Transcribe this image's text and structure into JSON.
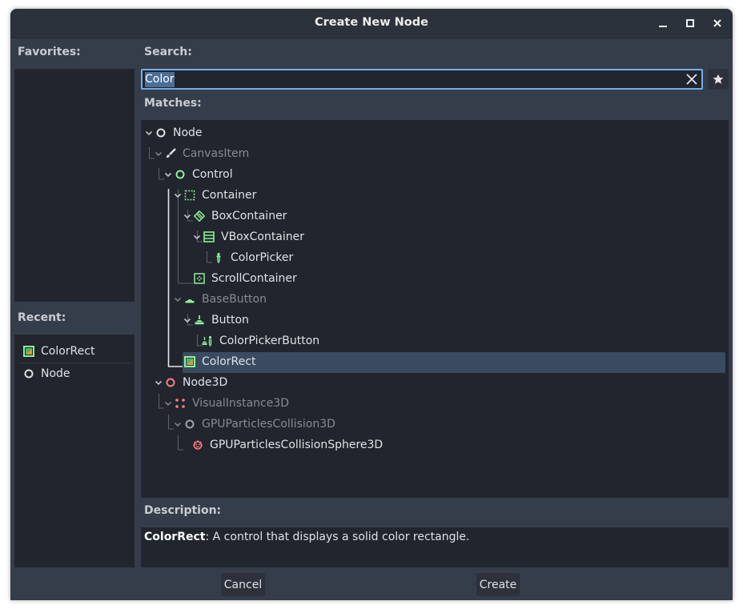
{
  "window": {
    "title": "Create New Node"
  },
  "favorites": {
    "label": "Favorites:"
  },
  "recent": {
    "label": "Recent:",
    "items": [
      {
        "label": "ColorRect",
        "icon": "colorrect-icon"
      },
      {
        "label": "Node",
        "icon": "node-icon"
      }
    ]
  },
  "search": {
    "label": "Search:",
    "value": "Color"
  },
  "matches": {
    "label": "Matches:",
    "items": [
      {
        "label": "Node",
        "icon": "node-icon",
        "dimmed": false
      },
      {
        "label": "CanvasItem",
        "icon": "canvasitem-icon",
        "dimmed": true
      },
      {
        "label": "Control",
        "icon": "control-icon",
        "dimmed": false
      },
      {
        "label": "Container",
        "icon": "container-icon",
        "dimmed": false
      },
      {
        "label": "BoxContainer",
        "icon": "boxcontainer-icon",
        "dimmed": false
      },
      {
        "label": "VBoxContainer",
        "icon": "vboxcontainer-icon",
        "dimmed": false
      },
      {
        "label": "ColorPicker",
        "icon": "colorpicker-icon",
        "dimmed": false
      },
      {
        "label": "ScrollContainer",
        "icon": "scrollcontainer-icon",
        "dimmed": false
      },
      {
        "label": "BaseButton",
        "icon": "basebutton-icon",
        "dimmed": true
      },
      {
        "label": "Button",
        "icon": "button-icon",
        "dimmed": false
      },
      {
        "label": "ColorPickerButton",
        "icon": "colorpickerbutton-icon",
        "dimmed": false
      },
      {
        "label": "ColorRect",
        "icon": "colorrect-icon",
        "dimmed": false,
        "selected": true
      },
      {
        "label": "Node3D",
        "icon": "node3d-icon",
        "dimmed": false
      },
      {
        "label": "VisualInstance3D",
        "icon": "visualinstance3d-icon",
        "dimmed": true
      },
      {
        "label": "GPUParticlesCollision3D",
        "icon": "gpuparticlescollision3d-icon",
        "dimmed": true
      },
      {
        "label": "GPUParticlesCollisionSphere3D",
        "icon": "gpuparticlescollisionsphere3d-icon",
        "dimmed": false
      }
    ]
  },
  "description": {
    "label": "Description:",
    "name": "ColorRect",
    "text": ": A control that displays a solid color rectangle."
  },
  "buttons": {
    "cancel": "Cancel",
    "create": "Create"
  },
  "colors": {
    "control_green": "#8eef97",
    "node3d_red": "#fc7f7f",
    "node_white": "#e0e0e0",
    "accent_blue": "#70aee9",
    "selection": "#394b60"
  }
}
